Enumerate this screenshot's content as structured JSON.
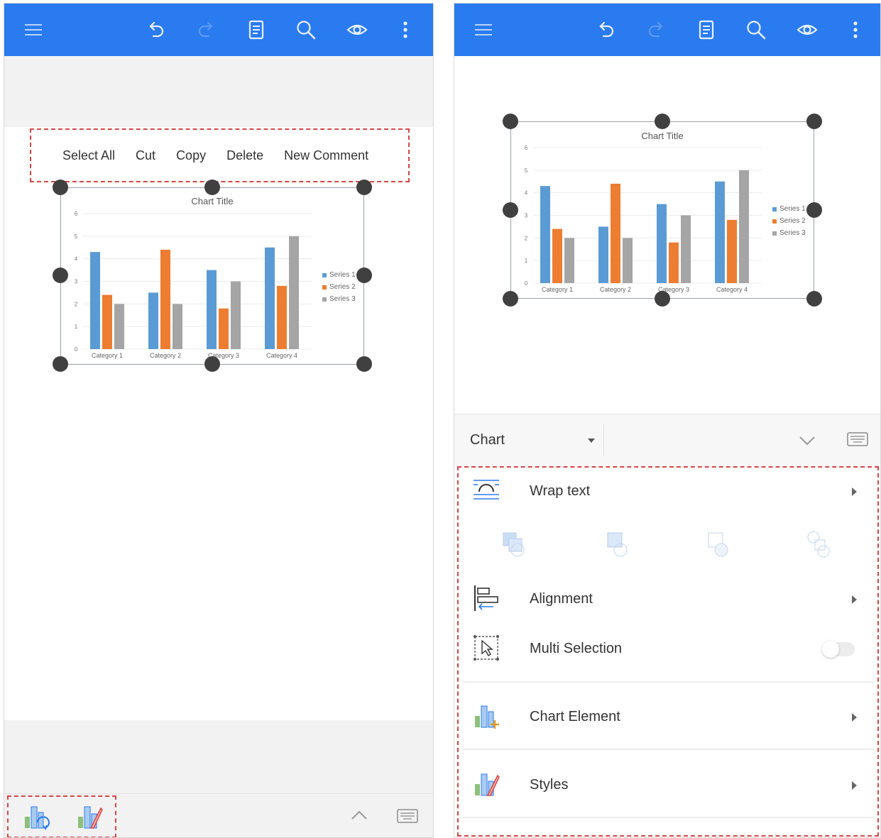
{
  "colors": {
    "topbar": "#2a7bef",
    "series1": "#5b9bd5",
    "series2": "#ed7d31",
    "series3": "#a5a5a5",
    "highlight": "#d64545"
  },
  "toolbar_icons": [
    "menu-icon",
    "undo-icon",
    "redo-icon",
    "document-icon",
    "search-icon",
    "eye-icon",
    "more-icon"
  ],
  "left": {
    "context_menu": {
      "select_all": "Select All",
      "cut": "Cut",
      "copy": "Copy",
      "delete": "Delete",
      "new_comment": "New Comment"
    }
  },
  "right": {
    "panel": {
      "dropdown_label": "Chart",
      "wrap_text": "Wrap text",
      "alignment": "Alignment",
      "multi_selection": "Multi Selection",
      "multi_selection_on": false,
      "chart_element": "Chart Element",
      "styles": "Styles"
    }
  },
  "chart_data": {
    "type": "bar",
    "title": "Chart Title",
    "categories": [
      "Category 1",
      "Category 2",
      "Category 3",
      "Category 4"
    ],
    "series": [
      {
        "name": "Series 1",
        "values": [
          4.3,
          2.5,
          3.5,
          4.5
        ]
      },
      {
        "name": "Series 2",
        "values": [
          2.4,
          4.4,
          1.8,
          2.8
        ]
      },
      {
        "name": "Series 3",
        "values": [
          2,
          2,
          3,
          5
        ]
      }
    ],
    "ylim": [
      0,
      6
    ],
    "yticks": [
      "0",
      "1",
      "2",
      "3",
      "4",
      "5",
      "6"
    ],
    "grid": true,
    "legend_position": "right"
  }
}
